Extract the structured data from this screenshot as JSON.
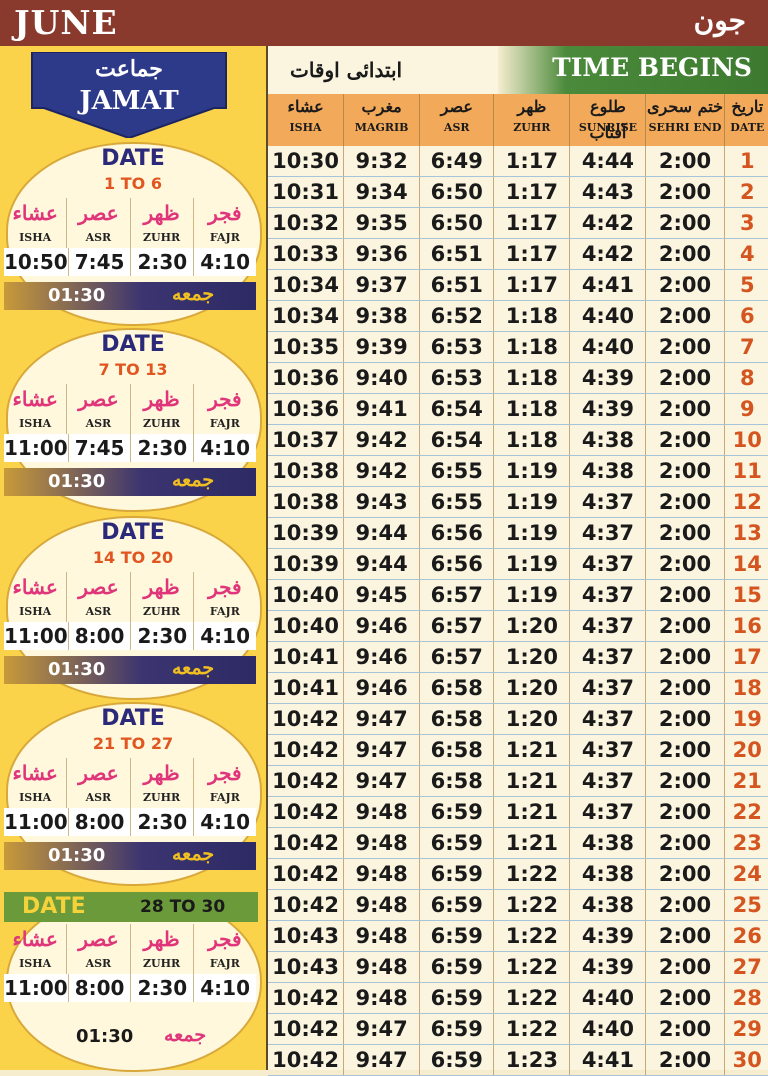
{
  "banner": {
    "title_en": "JUNE",
    "title_ur": "جون"
  },
  "jamat": {
    "label_ur": "جماعت",
    "label_en": "JAMAT",
    "prayer_names_ur": [
      "عشاء",
      "عصر",
      "ظهر",
      "فجر"
    ],
    "prayer_names_en": [
      "ISHA",
      "ASR",
      "ZUHR",
      "FAJR"
    ],
    "jumma_ur": "جمعه",
    "blocks": [
      {
        "date_label": "DATE",
        "range": "1 TO 6",
        "times": [
          "10:50",
          "7:45",
          "2:30",
          "4:10"
        ],
        "jumma": "01:30"
      },
      {
        "date_label": "DATE",
        "range": "7 TO 13",
        "times": [
          "11:00",
          "7:45",
          "2:30",
          "4:10"
        ],
        "jumma": "01:30"
      },
      {
        "date_label": "DATE",
        "range": "14 TO 20",
        "times": [
          "11:00",
          "8:00",
          "2:30",
          "4:10"
        ],
        "jumma": "01:30"
      },
      {
        "date_label": "DATE",
        "range": "21 TO 27",
        "times": [
          "11:00",
          "8:00",
          "2:30",
          "4:10"
        ],
        "jumma": "01:30"
      },
      {
        "date_label": "DATE",
        "range": "28 TO 30",
        "times": [
          "11:00",
          "8:00",
          "2:30",
          "4:10"
        ],
        "jumma": "01:30"
      }
    ]
  },
  "table": {
    "title_ur": "ابتدائی اوقات",
    "title_en": "TIME BEGINS",
    "columns": [
      {
        "ur": "عشاء",
        "en": "ISHA"
      },
      {
        "ur": "مغرب",
        "en": "MAGRIB"
      },
      {
        "ur": "عصر",
        "en": "ASR"
      },
      {
        "ur": "ظهر",
        "en": "ZUHR"
      },
      {
        "ur": "طلوع آفتاب",
        "en": "SUNRISE"
      },
      {
        "ur": "ختم سحری",
        "en": "SEHRI END"
      },
      {
        "ur": "تاریخ",
        "en": "DATE"
      }
    ],
    "rows": [
      [
        "10:30",
        "9:32",
        "6:49",
        "1:17",
        "4:44",
        "2:00",
        "1"
      ],
      [
        "10:31",
        "9:34",
        "6:50",
        "1:17",
        "4:43",
        "2:00",
        "2"
      ],
      [
        "10:32",
        "9:35",
        "6:50",
        "1:17",
        "4:42",
        "2:00",
        "3"
      ],
      [
        "10:33",
        "9:36",
        "6:51",
        "1:17",
        "4:42",
        "2:00",
        "4"
      ],
      [
        "10:34",
        "9:37",
        "6:51",
        "1:17",
        "4:41",
        "2:00",
        "5"
      ],
      [
        "10:34",
        "9:38",
        "6:52",
        "1:18",
        "4:40",
        "2:00",
        "6"
      ],
      [
        "10:35",
        "9:39",
        "6:53",
        "1:18",
        "4:40",
        "2:00",
        "7"
      ],
      [
        "10:36",
        "9:40",
        "6:53",
        "1:18",
        "4:39",
        "2:00",
        "8"
      ],
      [
        "10:36",
        "9:41",
        "6:54",
        "1:18",
        "4:39",
        "2:00",
        "9"
      ],
      [
        "10:37",
        "9:42",
        "6:54",
        "1:18",
        "4:38",
        "2:00",
        "10"
      ],
      [
        "10:38",
        "9:42",
        "6:55",
        "1:19",
        "4:38",
        "2:00",
        "11"
      ],
      [
        "10:38",
        "9:43",
        "6:55",
        "1:19",
        "4:37",
        "2:00",
        "12"
      ],
      [
        "10:39",
        "9:44",
        "6:56",
        "1:19",
        "4:37",
        "2:00",
        "13"
      ],
      [
        "10:39",
        "9:44",
        "6:56",
        "1:19",
        "4:37",
        "2:00",
        "14"
      ],
      [
        "10:40",
        "9:45",
        "6:57",
        "1:19",
        "4:37",
        "2:00",
        "15"
      ],
      [
        "10:40",
        "9:46",
        "6:57",
        "1:20",
        "4:37",
        "2:00",
        "16"
      ],
      [
        "10:41",
        "9:46",
        "6:57",
        "1:20",
        "4:37",
        "2:00",
        "17"
      ],
      [
        "10:41",
        "9:46",
        "6:58",
        "1:20",
        "4:37",
        "2:00",
        "18"
      ],
      [
        "10:42",
        "9:47",
        "6:58",
        "1:20",
        "4:37",
        "2:00",
        "19"
      ],
      [
        "10:42",
        "9:47",
        "6:58",
        "1:21",
        "4:37",
        "2:00",
        "20"
      ],
      [
        "10:42",
        "9:47",
        "6:58",
        "1:21",
        "4:37",
        "2:00",
        "21"
      ],
      [
        "10:42",
        "9:48",
        "6:59",
        "1:21",
        "4:37",
        "2:00",
        "22"
      ],
      [
        "10:42",
        "9:48",
        "6:59",
        "1:21",
        "4:38",
        "2:00",
        "23"
      ],
      [
        "10:42",
        "9:48",
        "6:59",
        "1:22",
        "4:38",
        "2:00",
        "24"
      ],
      [
        "10:42",
        "9:48",
        "6:59",
        "1:22",
        "4:38",
        "2:00",
        "25"
      ],
      [
        "10:43",
        "9:48",
        "6:59",
        "1:22",
        "4:39",
        "2:00",
        "26"
      ],
      [
        "10:43",
        "9:48",
        "6:59",
        "1:22",
        "4:39",
        "2:00",
        "27"
      ],
      [
        "10:42",
        "9:48",
        "6:59",
        "1:22",
        "4:40",
        "2:00",
        "28"
      ],
      [
        "10:42",
        "9:47",
        "6:59",
        "1:22",
        "4:40",
        "2:00",
        "29"
      ],
      [
        "10:42",
        "9:47",
        "6:59",
        "1:23",
        "4:41",
        "2:00",
        "30"
      ]
    ]
  }
}
